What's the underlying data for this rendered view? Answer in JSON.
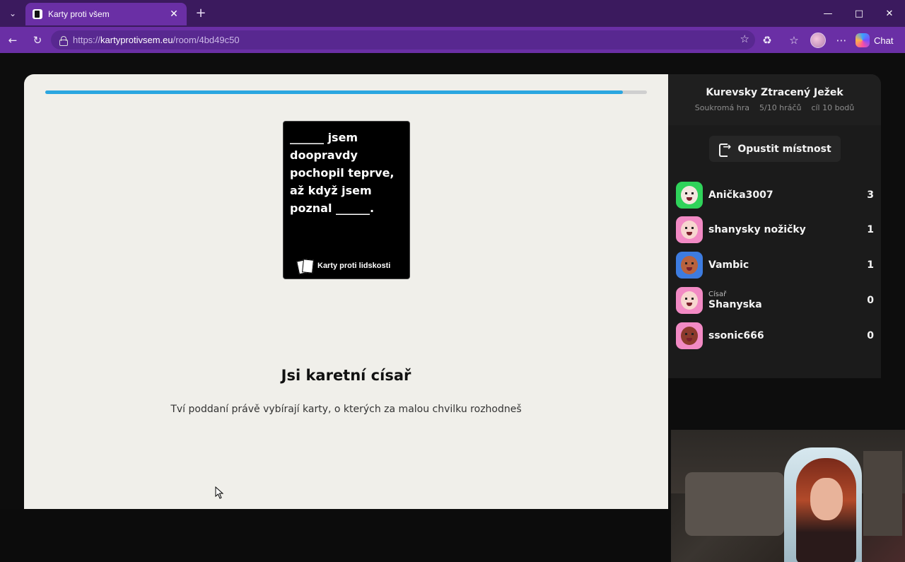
{
  "browser": {
    "tab_title": "Karty proti všem",
    "url_prefix": "https://",
    "url_domain": "kartyprotivsem.eu",
    "url_path": "/room/4bd49c50",
    "chat_label": "Chat",
    "icons": {
      "tab_menu": "chevron-down-icon",
      "close": "close-icon",
      "new_tab": "plus-icon",
      "back": "back-arrow-icon",
      "reload": "reload-icon",
      "favorite": "star-icon",
      "extensions": "puzzle-icon",
      "favorites": "favorites-icon",
      "more": "more-icon"
    }
  },
  "game": {
    "progress": 0.96,
    "black_card": {
      "text": "______ jsem doopravdy pochopil teprve, až když jsem poznal ______.",
      "brand": "Karty proti lidskosti"
    },
    "czar_title": "Jsi karetní císař",
    "czar_subtitle": "Tví poddaní právě vybírají karty, o kterých za malou chvilku rozhodneš"
  },
  "sidebar": {
    "room_name": "Kurevsky Ztracený Ježek",
    "room_type": "Soukromá hra",
    "players_count": "5/10 hráčů",
    "goal": "cíl 10 bodů",
    "leave_label": "Opustit místnost",
    "players": [
      {
        "name": "Anička3007",
        "role": "",
        "score": "3",
        "bg": "#2fd35a",
        "face": "#f3e6df"
      },
      {
        "name": "shanysky nožičky",
        "role": "",
        "score": "1",
        "bg": "#f28ac4",
        "face": "#f7d6cf"
      },
      {
        "name": "Vambic",
        "role": "",
        "score": "1",
        "bg": "#3d7ce0",
        "face": "#b8623e"
      },
      {
        "name": "Shanyska",
        "role": "Císař",
        "score": "0",
        "bg": "#f28ac4",
        "face": "#f7d6cf"
      },
      {
        "name": "ssonic666",
        "role": "",
        "score": "0",
        "bg": "#f28ac4",
        "face": "#8c3a2c"
      }
    ]
  },
  "colors": {
    "tab_bg": "#3b1a5e",
    "toolbar_bg": "#6a2fa5",
    "progress": "#2ba6e0",
    "panel_bg": "#f0efea",
    "sidebar_bg": "#1b1b1b"
  }
}
